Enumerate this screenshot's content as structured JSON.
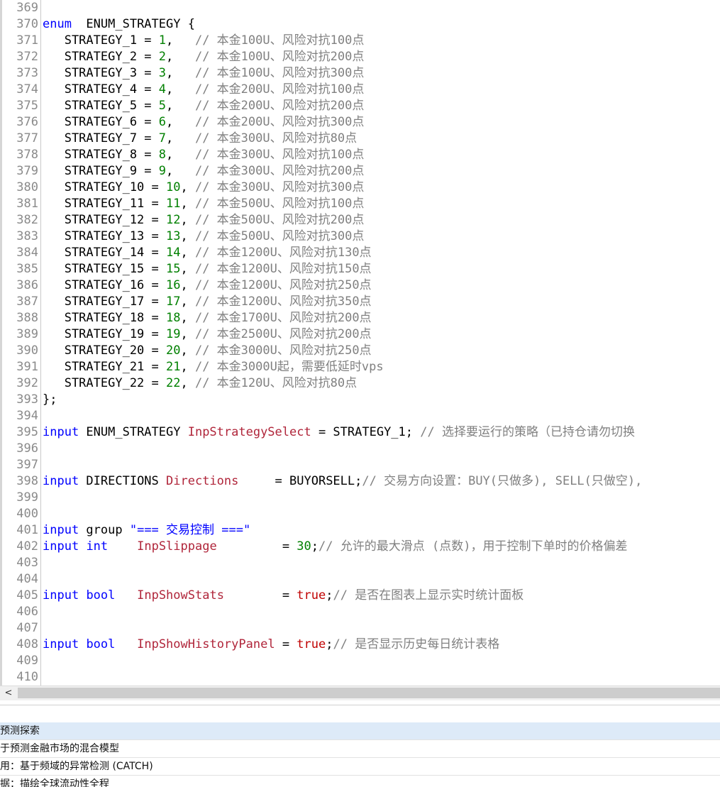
{
  "editor": {
    "lines": [
      {
        "n": "369",
        "t": []
      },
      {
        "n": "370",
        "t": [
          [
            "kw",
            "enum"
          ],
          [
            "",
            "  ENUM_STRATEGY {"
          ]
        ]
      },
      {
        "n": "371",
        "t": [
          [
            "",
            "   STRATEGY_1 = "
          ],
          [
            "num",
            "1"
          ],
          [
            "",
            ",   "
          ],
          [
            "cm",
            "// 本金100U、风险对抗100点"
          ]
        ]
      },
      {
        "n": "372",
        "t": [
          [
            "",
            "   STRATEGY_2 = "
          ],
          [
            "num",
            "2"
          ],
          [
            "",
            ",   "
          ],
          [
            "cm",
            "// 本金100U、风险对抗200点"
          ]
        ]
      },
      {
        "n": "373",
        "t": [
          [
            "",
            "   STRATEGY_3 = "
          ],
          [
            "num",
            "3"
          ],
          [
            "",
            ",   "
          ],
          [
            "cm",
            "// 本金100U、风险对抗300点"
          ]
        ]
      },
      {
        "n": "374",
        "t": [
          [
            "",
            "   STRATEGY_4 = "
          ],
          [
            "num",
            "4"
          ],
          [
            "",
            ",   "
          ],
          [
            "cm",
            "// 本金200U、风险对抗100点"
          ]
        ]
      },
      {
        "n": "375",
        "t": [
          [
            "",
            "   STRATEGY_5 = "
          ],
          [
            "num",
            "5"
          ],
          [
            "",
            ",   "
          ],
          [
            "cm",
            "// 本金200U、风险对抗200点"
          ]
        ]
      },
      {
        "n": "376",
        "t": [
          [
            "",
            "   STRATEGY_6 = "
          ],
          [
            "num",
            "6"
          ],
          [
            "",
            ",   "
          ],
          [
            "cm",
            "// 本金200U、风险对抗300点"
          ]
        ]
      },
      {
        "n": "377",
        "t": [
          [
            "",
            "   STRATEGY_7 = "
          ],
          [
            "num",
            "7"
          ],
          [
            "",
            ",   "
          ],
          [
            "cm",
            "// 本金300U、风险对抗80点"
          ]
        ]
      },
      {
        "n": "378",
        "t": [
          [
            "",
            "   STRATEGY_8 = "
          ],
          [
            "num",
            "8"
          ],
          [
            "",
            ",   "
          ],
          [
            "cm",
            "// 本金300U、风险对抗100点"
          ]
        ]
      },
      {
        "n": "379",
        "t": [
          [
            "",
            "   STRATEGY_9 = "
          ],
          [
            "num",
            "9"
          ],
          [
            "",
            ",   "
          ],
          [
            "cm",
            "// 本金300U、风险对抗200点"
          ]
        ]
      },
      {
        "n": "380",
        "t": [
          [
            "",
            "   STRATEGY_10 = "
          ],
          [
            "num",
            "10"
          ],
          [
            "",
            ", "
          ],
          [
            "cm",
            "// 本金300U、风险对抗300点"
          ]
        ]
      },
      {
        "n": "381",
        "t": [
          [
            "",
            "   STRATEGY_11 = "
          ],
          [
            "num",
            "11"
          ],
          [
            "",
            ", "
          ],
          [
            "cm",
            "// 本金500U、风险对抗100点"
          ]
        ]
      },
      {
        "n": "382",
        "t": [
          [
            "",
            "   STRATEGY_12 = "
          ],
          [
            "num",
            "12"
          ],
          [
            "",
            ", "
          ],
          [
            "cm",
            "// 本金500U、风险对抗200点"
          ]
        ]
      },
      {
        "n": "383",
        "t": [
          [
            "",
            "   STRATEGY_13 = "
          ],
          [
            "num",
            "13"
          ],
          [
            "",
            ", "
          ],
          [
            "cm",
            "// 本金500U、风险对抗300点"
          ]
        ]
      },
      {
        "n": "384",
        "t": [
          [
            "",
            "   STRATEGY_14 = "
          ],
          [
            "num",
            "14"
          ],
          [
            "",
            ", "
          ],
          [
            "cm",
            "// 本金1200U、风险对抗130点"
          ]
        ]
      },
      {
        "n": "385",
        "t": [
          [
            "",
            "   STRATEGY_15 = "
          ],
          [
            "num",
            "15"
          ],
          [
            "",
            ", "
          ],
          [
            "cm",
            "// 本金1200U、风险对抗150点"
          ]
        ]
      },
      {
        "n": "386",
        "t": [
          [
            "",
            "   STRATEGY_16 = "
          ],
          [
            "num",
            "16"
          ],
          [
            "",
            ", "
          ],
          [
            "cm",
            "// 本金1200U、风险对抗250点"
          ]
        ]
      },
      {
        "n": "387",
        "t": [
          [
            "",
            "   STRATEGY_17 = "
          ],
          [
            "num",
            "17"
          ],
          [
            "",
            ", "
          ],
          [
            "cm",
            "// 本金1200U、风险对抗350点"
          ]
        ]
      },
      {
        "n": "388",
        "t": [
          [
            "",
            "   STRATEGY_18 = "
          ],
          [
            "num",
            "18"
          ],
          [
            "",
            ", "
          ],
          [
            "cm",
            "// 本金1700U、风险对抗200点"
          ]
        ]
      },
      {
        "n": "389",
        "t": [
          [
            "",
            "   STRATEGY_19 = "
          ],
          [
            "num",
            "19"
          ],
          [
            "",
            ", "
          ],
          [
            "cm",
            "// 本金2500U、风险对抗200点"
          ]
        ]
      },
      {
        "n": "390",
        "t": [
          [
            "",
            "   STRATEGY_20 = "
          ],
          [
            "num",
            "20"
          ],
          [
            "",
            ", "
          ],
          [
            "cm",
            "// 本金3000U、风险对抗250点"
          ]
        ]
      },
      {
        "n": "391",
        "t": [
          [
            "",
            "   STRATEGY_21 = "
          ],
          [
            "num",
            "21"
          ],
          [
            "",
            ", "
          ],
          [
            "cm",
            "// 本金3000U起，需要低延时vps"
          ]
        ]
      },
      {
        "n": "392",
        "t": [
          [
            "",
            "   STRATEGY_22 = "
          ],
          [
            "num",
            "22"
          ],
          [
            "",
            ", "
          ],
          [
            "cm",
            "// 本金120U、风险对抗80点"
          ]
        ]
      },
      {
        "n": "393",
        "t": [
          [
            "",
            "};"
          ]
        ]
      },
      {
        "n": "394",
        "t": []
      },
      {
        "n": "395",
        "t": [
          [
            "kw",
            "input"
          ],
          [
            "",
            " ENUM_STRATEGY "
          ],
          [
            "id",
            "InpStrategySelect"
          ],
          [
            "",
            " = STRATEGY_1; "
          ],
          [
            "cm",
            "// 选择要运行的策略（已持仓请勿切换"
          ]
        ]
      },
      {
        "n": "396",
        "t": []
      },
      {
        "n": "397",
        "t": []
      },
      {
        "n": "398",
        "t": [
          [
            "kw",
            "input"
          ],
          [
            "",
            " DIRECTIONS "
          ],
          [
            "id",
            "Directions"
          ],
          [
            "",
            "     = BUYORSELL;"
          ],
          [
            "cm",
            "// 交易方向设置：BUY(只做多), SELL(只做空),"
          ]
        ]
      },
      {
        "n": "399",
        "t": []
      },
      {
        "n": "400",
        "t": []
      },
      {
        "n": "401",
        "t": [
          [
            "kw",
            "input"
          ],
          [
            "",
            " group "
          ],
          [
            "str",
            "\"=== 交易控制 ===\""
          ]
        ]
      },
      {
        "n": "402",
        "t": [
          [
            "kw",
            "input"
          ],
          [
            "",
            " "
          ],
          [
            "kw",
            "int"
          ],
          [
            "",
            "    "
          ],
          [
            "id",
            "InpSlippage"
          ],
          [
            "",
            "         = "
          ],
          [
            "num",
            "30"
          ],
          [
            "",
            ";"
          ],
          [
            "cm",
            "// 允许的最大滑点 (点数)，用于控制下单时的价格偏差"
          ]
        ]
      },
      {
        "n": "403",
        "t": []
      },
      {
        "n": "404",
        "t": []
      },
      {
        "n": "405",
        "t": [
          [
            "kw",
            "input"
          ],
          [
            "",
            " "
          ],
          [
            "kw",
            "bool"
          ],
          [
            "",
            "   "
          ],
          [
            "id",
            "InpShowStats"
          ],
          [
            "",
            "        = "
          ],
          [
            "val",
            "true"
          ],
          [
            "",
            ";"
          ],
          [
            "cm",
            "// 是否在图表上显示实时统计面板"
          ]
        ]
      },
      {
        "n": "406",
        "t": []
      },
      {
        "n": "407",
        "t": []
      },
      {
        "n": "408",
        "t": [
          [
            "kw",
            "input"
          ],
          [
            "",
            " "
          ],
          [
            "kw",
            "bool"
          ],
          [
            "",
            "   "
          ],
          [
            "id",
            "InpShowHistoryPanel"
          ],
          [
            "",
            " = "
          ],
          [
            "val",
            "true"
          ],
          [
            "",
            ";"
          ],
          [
            "cm",
            "// 是否显示历史每日统计表格"
          ]
        ]
      },
      {
        "n": "409",
        "t": []
      },
      {
        "n": "410",
        "t": []
      }
    ]
  },
  "scrollbar": {
    "left_arrow": "<"
  },
  "bottom_panel": {
    "rows": [
      {
        "text": "预测探索",
        "selected": true
      },
      {
        "text": "于预测金融市场的混合模型",
        "selected": false
      },
      {
        "text": "用：基于频域的异常检测 (CATCH)",
        "selected": false
      },
      {
        "text": "据：描绘全球流动性全程",
        "selected": false
      }
    ]
  }
}
